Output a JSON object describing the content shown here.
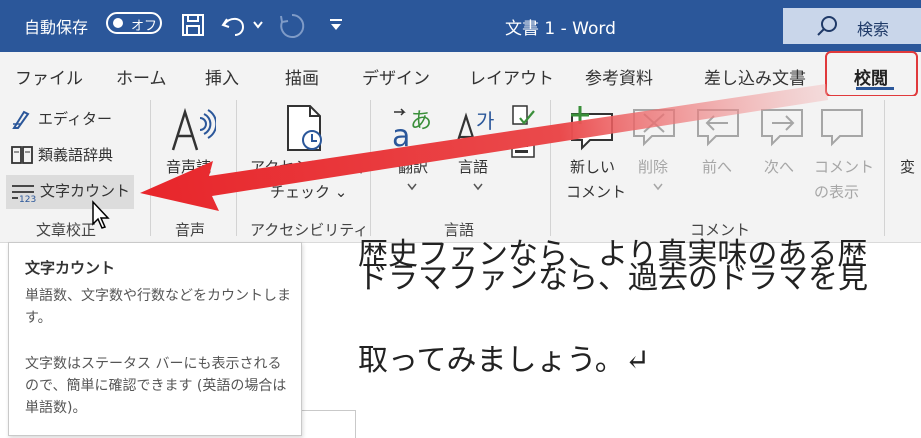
{
  "titlebar": {
    "autosave_label": "自動保存",
    "autosave_state": "オフ",
    "doc_title": "文書 1  -  Word",
    "search_label": "検索"
  },
  "tabs": [
    {
      "label": "ファイル"
    },
    {
      "label": "ホーム"
    },
    {
      "label": "挿入"
    },
    {
      "label": "描画"
    },
    {
      "label": "デザイン"
    },
    {
      "label": "レイアウト"
    },
    {
      "label": "参考資料"
    },
    {
      "label": "差し込み文書"
    },
    {
      "label": "校閲",
      "selected": true
    }
  ],
  "ribbon": {
    "proofing": {
      "editor": "エディター",
      "thesaurus": "類義語辞典",
      "word_count": "文字カウント",
      "group_label": "文章校正"
    },
    "speech": {
      "read_aloud_line1": "音声読",
      "read_aloud_line2": "上げ",
      "group_label": "音声"
    },
    "accessibility": {
      "check_line1": "アクセシビリティ",
      "check_line2": "チェック ⌄",
      "group_label": "アクセシビリティ"
    },
    "language": {
      "translate": "翻訳",
      "language": "言語",
      "group_label": "言語"
    },
    "comments": {
      "new_comment_line1": "新しい",
      "new_comment_line2": "コメント",
      "delete": "削除",
      "previous": "前へ",
      "next": "次へ",
      "show_line1": "コメント",
      "show_line2": "の表示",
      "group_label": "コメント"
    },
    "tracking": {
      "partial_label": "変"
    }
  },
  "document": {
    "line1": "歴史ファンなら、より真実味のある歴",
    "line2": "ドラマファンなら、過去のドラマを見",
    "line3": "取ってみましょう。↵"
  },
  "tooltip": {
    "title": "文字カウント",
    "para1": "単語数、文字数や行数などをカウントします。",
    "para2": "文字数はステータス バーにも表示されるので、簡単に確認できます (英語の場合は単語数)。"
  },
  "colors": {
    "word_blue": "#2b579a",
    "highlight_red": "#e0393b",
    "ribbon_bg": "#f3f3f3"
  }
}
